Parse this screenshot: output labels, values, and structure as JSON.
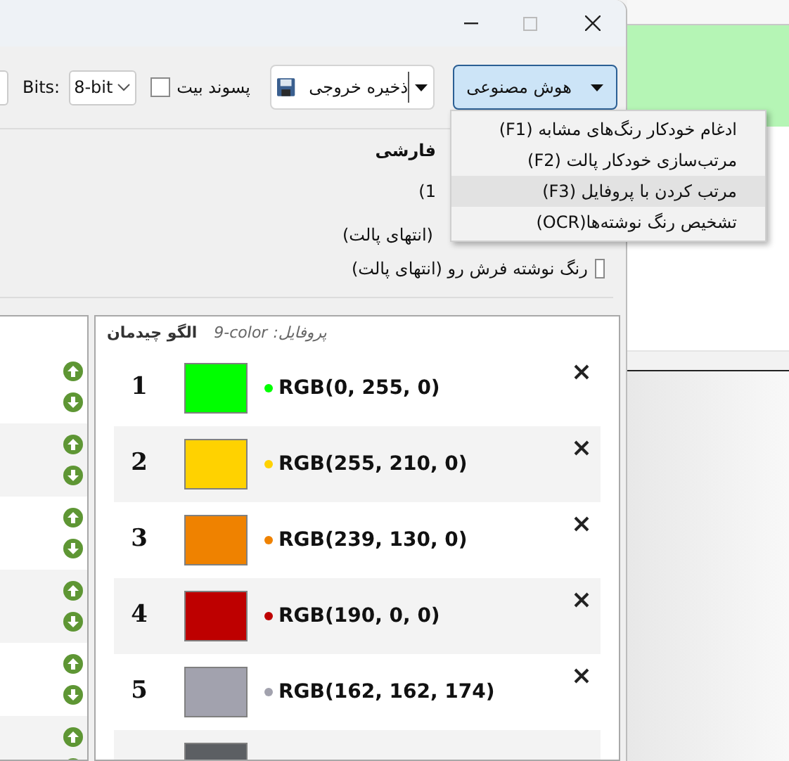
{
  "toolbar": {
    "ai_button": {
      "label": "هوش مصنوعی",
      "pressed": true
    },
    "export_button": {
      "label": "ذخیره خروجی"
    },
    "bit_suffix": {
      "label": "پسوند بیت",
      "checked": false
    },
    "bits": {
      "label": "Bits:",
      "value": "8-bit"
    }
  },
  "menu": {
    "items": [
      {
        "label": "ادغام خودکار رنگ‌های مشابه  (F1)",
        "selected": false
      },
      {
        "label": "مرتب‌سازی خودکار پالت  (F2)",
        "selected": false
      },
      {
        "label": "مرتب کردن با پروفایل  (F3)",
        "selected": true
      },
      {
        "label": "تشخیص رنگ نوشته‌ها(OCR)",
        "selected": false
      }
    ]
  },
  "options": {
    "heading": "فارشی",
    "line_2": "(1",
    "line_3": "(انتهای پالت)",
    "foreground_option": {
      "label": "رنگ نوشته فرش رو (انتهای پالت)",
      "checked": false
    }
  },
  "palette": {
    "profile": "پروفایل:",
    "profile_name": "9-color",
    "layout_label": "الگو چیدمان",
    "rows": [
      {
        "number": "1",
        "color": "#00ff00",
        "value": "RGB(0, 255, 0)"
      },
      {
        "number": "2",
        "color": "#ffd200",
        "value": "RGB(255, 210, 0)"
      },
      {
        "number": "3",
        "color": "#ef8200",
        "value": "RGB(239, 130, 0)"
      },
      {
        "number": "4",
        "color": "#be0000",
        "value": "RGB(190, 0, 0)"
      },
      {
        "number": "5",
        "color": "#a2a2ae",
        "value": "RGB(162, 162, 174)"
      },
      {
        "color": "#5c5f63"
      }
    ]
  }
}
